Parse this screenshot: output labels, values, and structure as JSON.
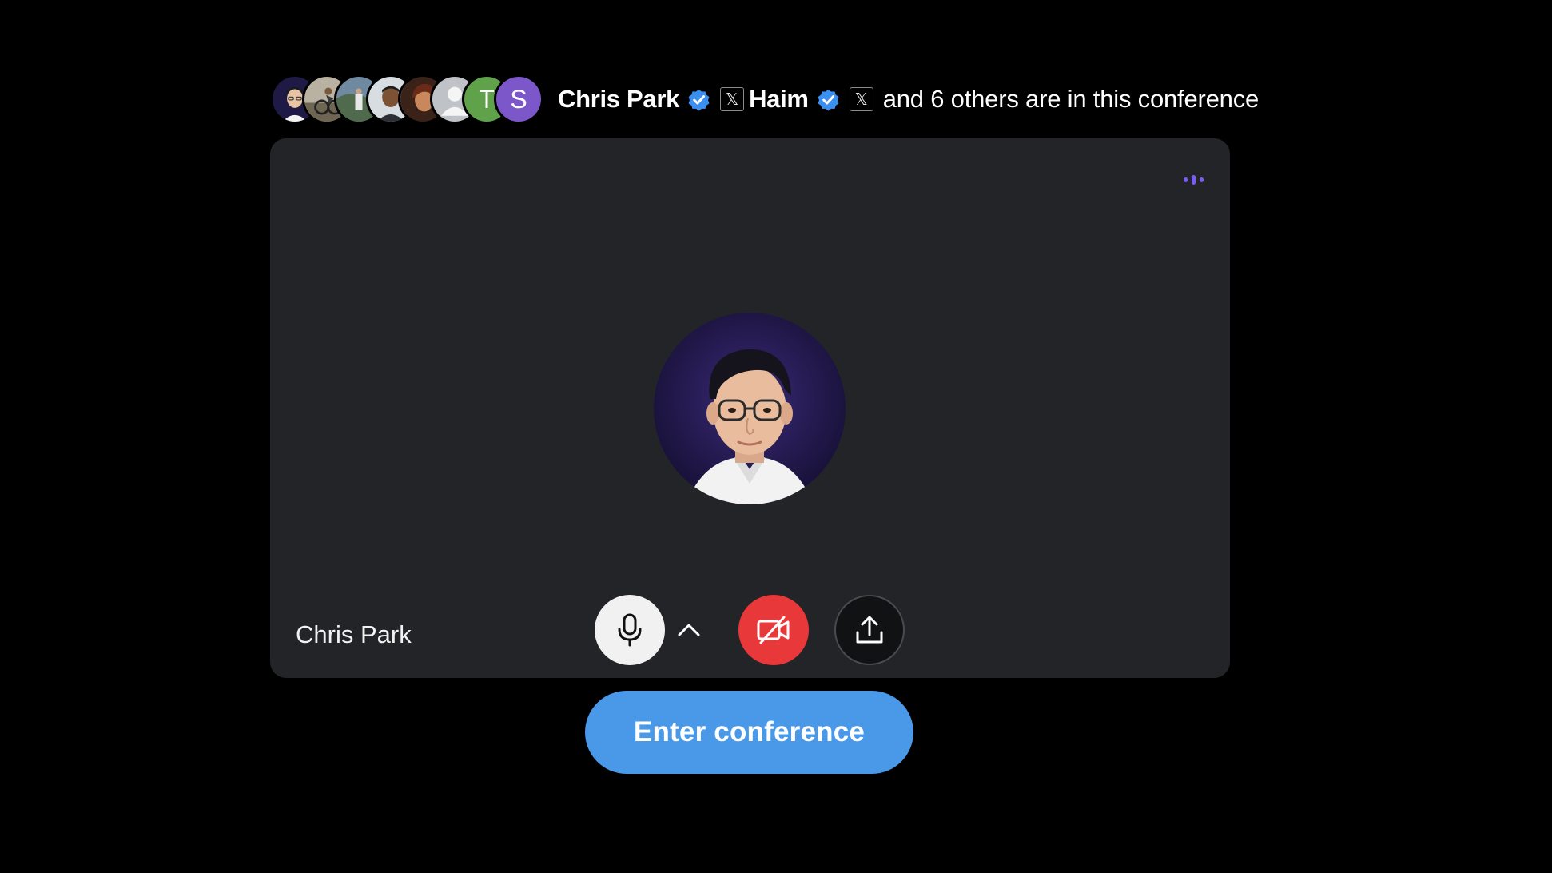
{
  "header": {
    "participants": [
      {
        "kind": "photo",
        "icon": "user-photo-1"
      },
      {
        "kind": "photo",
        "icon": "user-photo-2"
      },
      {
        "kind": "photo",
        "icon": "user-photo-3"
      },
      {
        "kind": "photo",
        "icon": "user-photo-4"
      },
      {
        "kind": "photo",
        "icon": "user-photo-5"
      },
      {
        "kind": "placeholder",
        "icon": "default-user-icon"
      },
      {
        "kind": "letter",
        "letter": "T",
        "color": "#5fa24a"
      },
      {
        "kind": "letter",
        "letter": "S",
        "color": "#7c57c9"
      }
    ],
    "name_1": "Chris Park",
    "name_2": "Haim",
    "x_badge": "𝕏",
    "rest_text": "and 6 others are in this conference",
    "verified_color": "#3b8ff0"
  },
  "preview": {
    "participant_name": "Chris Park",
    "audio_indicator_color": "#7c5cf5",
    "avatar_icon": "profile-photo"
  },
  "controls": {
    "mic_icon": "microphone-icon",
    "chevron_icon": "chevron-up-icon",
    "camera_icon": "camera-off-icon",
    "camera_bg": "#e8383a",
    "share_icon": "upload-icon"
  },
  "enter_button": {
    "label": "Enter conference",
    "bg": "#4a99e9"
  }
}
